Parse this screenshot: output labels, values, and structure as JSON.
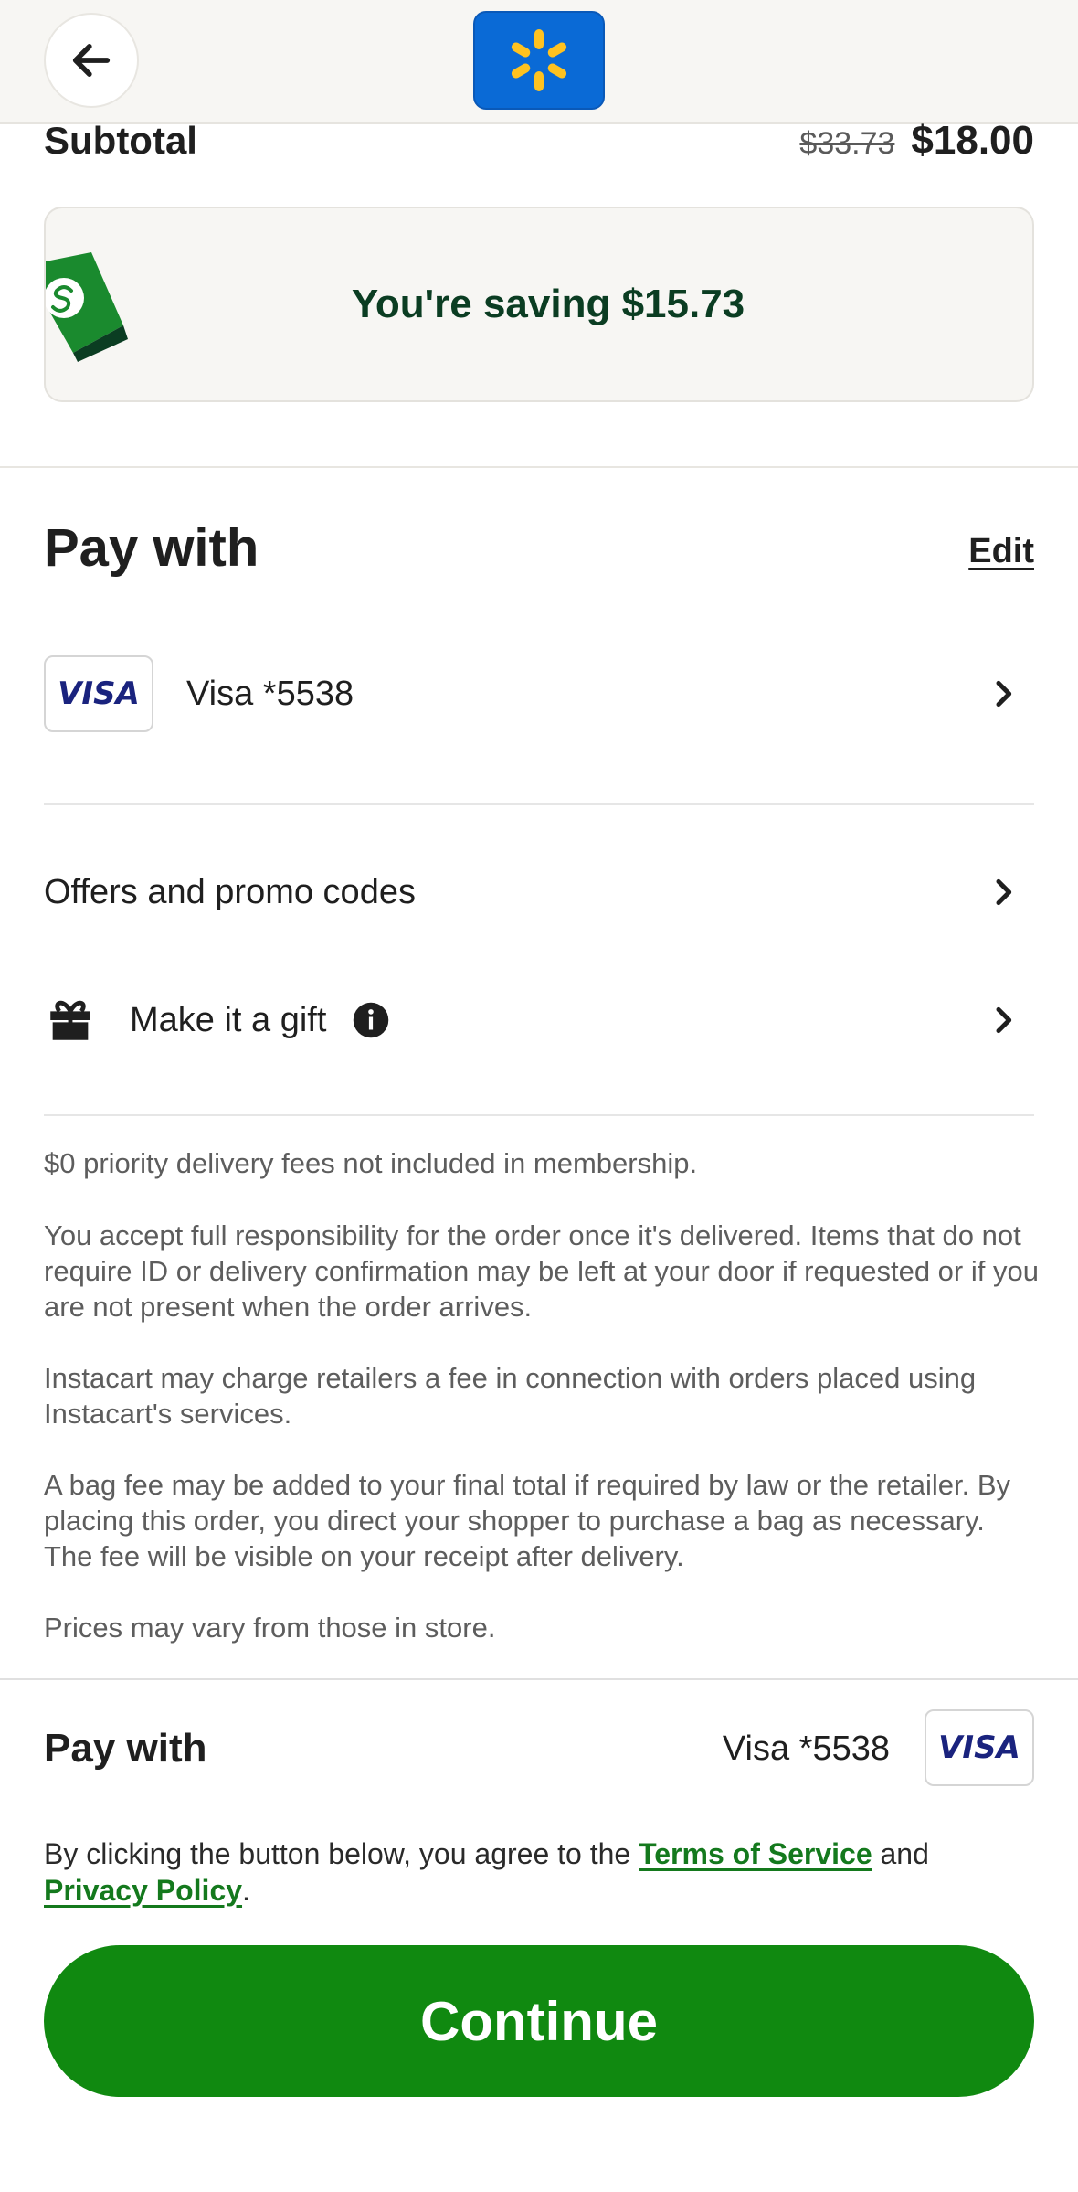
{
  "header": {
    "back_icon": "arrow-left-icon",
    "logo_icon": "walmart-spark-icon",
    "logo_bg": "#0a6ad6",
    "logo_spark": "#ffc220"
  },
  "subtotal": {
    "label": "Subtotal",
    "original_price": "$33.73",
    "price": "$18.00"
  },
  "savings": {
    "text": "You're saving $15.73",
    "icon": "price-tag-icon"
  },
  "pay_with": {
    "title": "Pay with",
    "edit_label": "Edit",
    "card_brand": "VISA",
    "card_label": "Visa *5538"
  },
  "options": [
    {
      "label": "Offers and promo codes",
      "icon": "chevron-right-icon"
    },
    {
      "label": "Make it a gift",
      "icon": "gift-icon",
      "info_icon": "info-icon"
    }
  ],
  "disclaimers": [
    "$0 priority delivery fees not included in membership.",
    "You accept full responsibility for the order once it's delivered. Items that do not require ID or delivery confirmation may be left at your door if requested or if you are not present when the order arrives.",
    "Instacart may charge retailers a fee in connection with orders placed using Instacart's services.",
    "A bag fee may be added to your final total if required by law or the retailer. By placing this order, you direct your shopper to purchase a bag as necessary. The fee will be visible on your receipt after delivery.",
    "Prices may vary from those in store."
  ],
  "footer": {
    "pay_with_label": "Pay with",
    "card_label": "Visa *5538",
    "card_brand": "VISA",
    "agree_prefix": "By clicking the button below, you agree to the ",
    "terms_label": "Terms of Service",
    "agree_mid": " and ",
    "privacy_label": "Privacy Policy",
    "agree_suffix": ".",
    "continue_label": "Continue"
  },
  "colors": {
    "brand_green": "#108910",
    "link_green": "#14791d",
    "savings_text": "#0b3d22",
    "visa_blue": "#1a237e"
  }
}
